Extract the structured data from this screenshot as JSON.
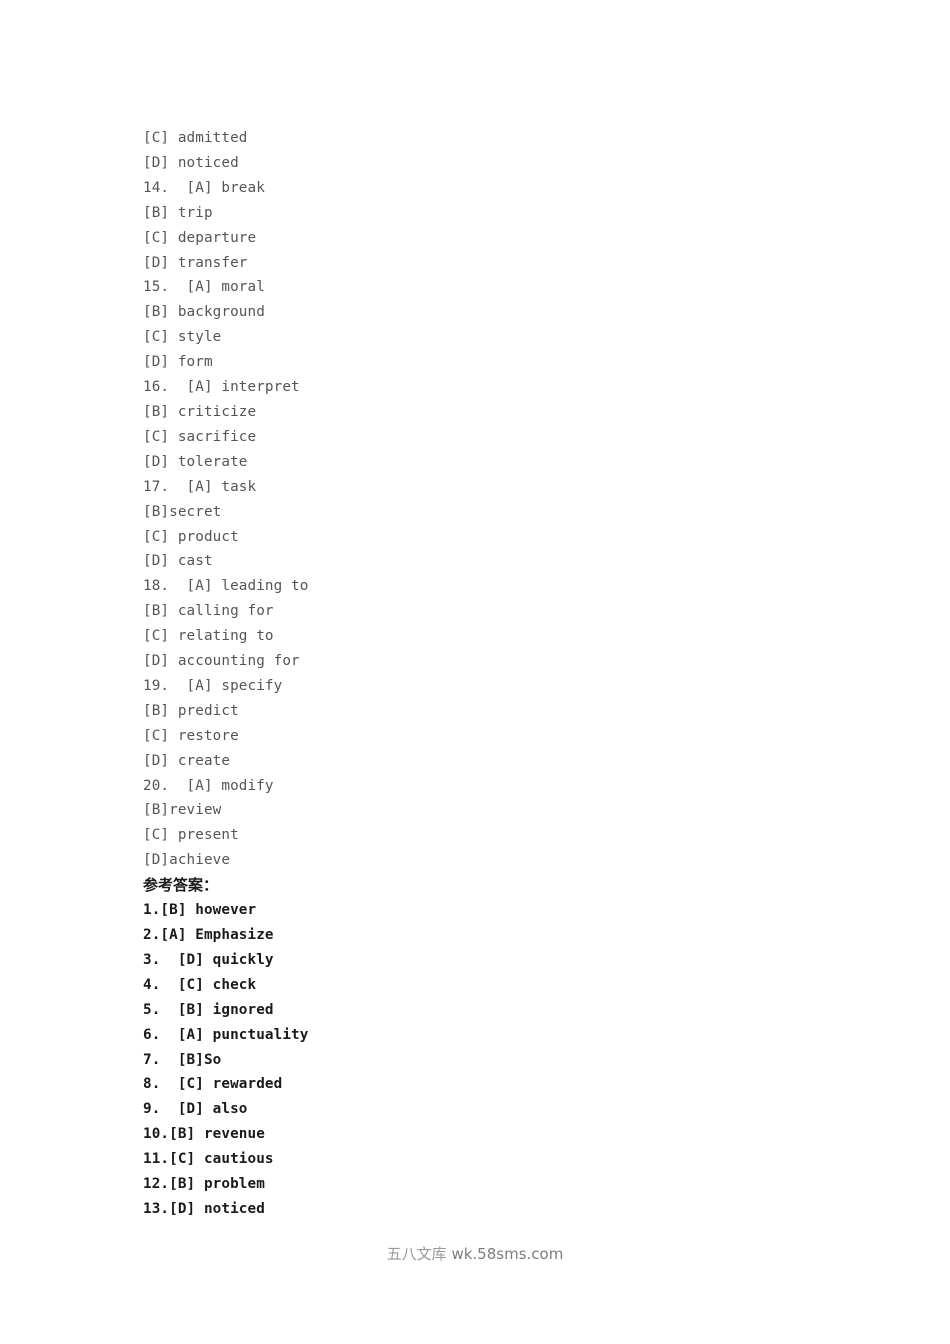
{
  "document": {
    "background_color": "#ffffff",
    "question_text_color": "#555555",
    "answer_text_color": "#1a1a1a",
    "watermark_color": "#8c8c8c"
  },
  "options_block": {
    "lines": [
      "[C] admitted",
      "[D] noticed",
      "14.  [A] break",
      "[B] trip",
      "[C] departure",
      "[D] transfer",
      "15.  [A] moral",
      "[B] background",
      "[C] style",
      "[D] form",
      "16.  [A] interpret",
      "[B] criticize",
      "[C] sacrifice",
      "[D] tolerate",
      "17.  [A] task",
      "[B]secret",
      "[C] product",
      "[D] cast",
      "18.  [A] leading to",
      "[B] calling for",
      "[C] relating to",
      "[D] accounting for",
      "19.  [A] specify",
      "[B] predict",
      "[C] restore",
      "[D] create",
      "20.  [A] modify",
      "[B]review",
      "[C] present",
      "[D]achieve"
    ]
  },
  "answer_key": {
    "heading": "参考答案：",
    "lines": [
      "1.[B] however",
      "2.[A] Emphasize",
      "3.  [D] quickly",
      "4.  [C] check",
      "5.  [B] ignored",
      "6.  [A] punctuality",
      "7.  [B]So",
      "8.  [C] rewarded",
      "9.  [D] also",
      "10.[B] revenue",
      "11.[C] cautious",
      "12.[B] problem",
      "13.[D] noticed"
    ]
  },
  "watermark": {
    "cjk": "五八文库",
    "url": " wk.58sms.com"
  }
}
